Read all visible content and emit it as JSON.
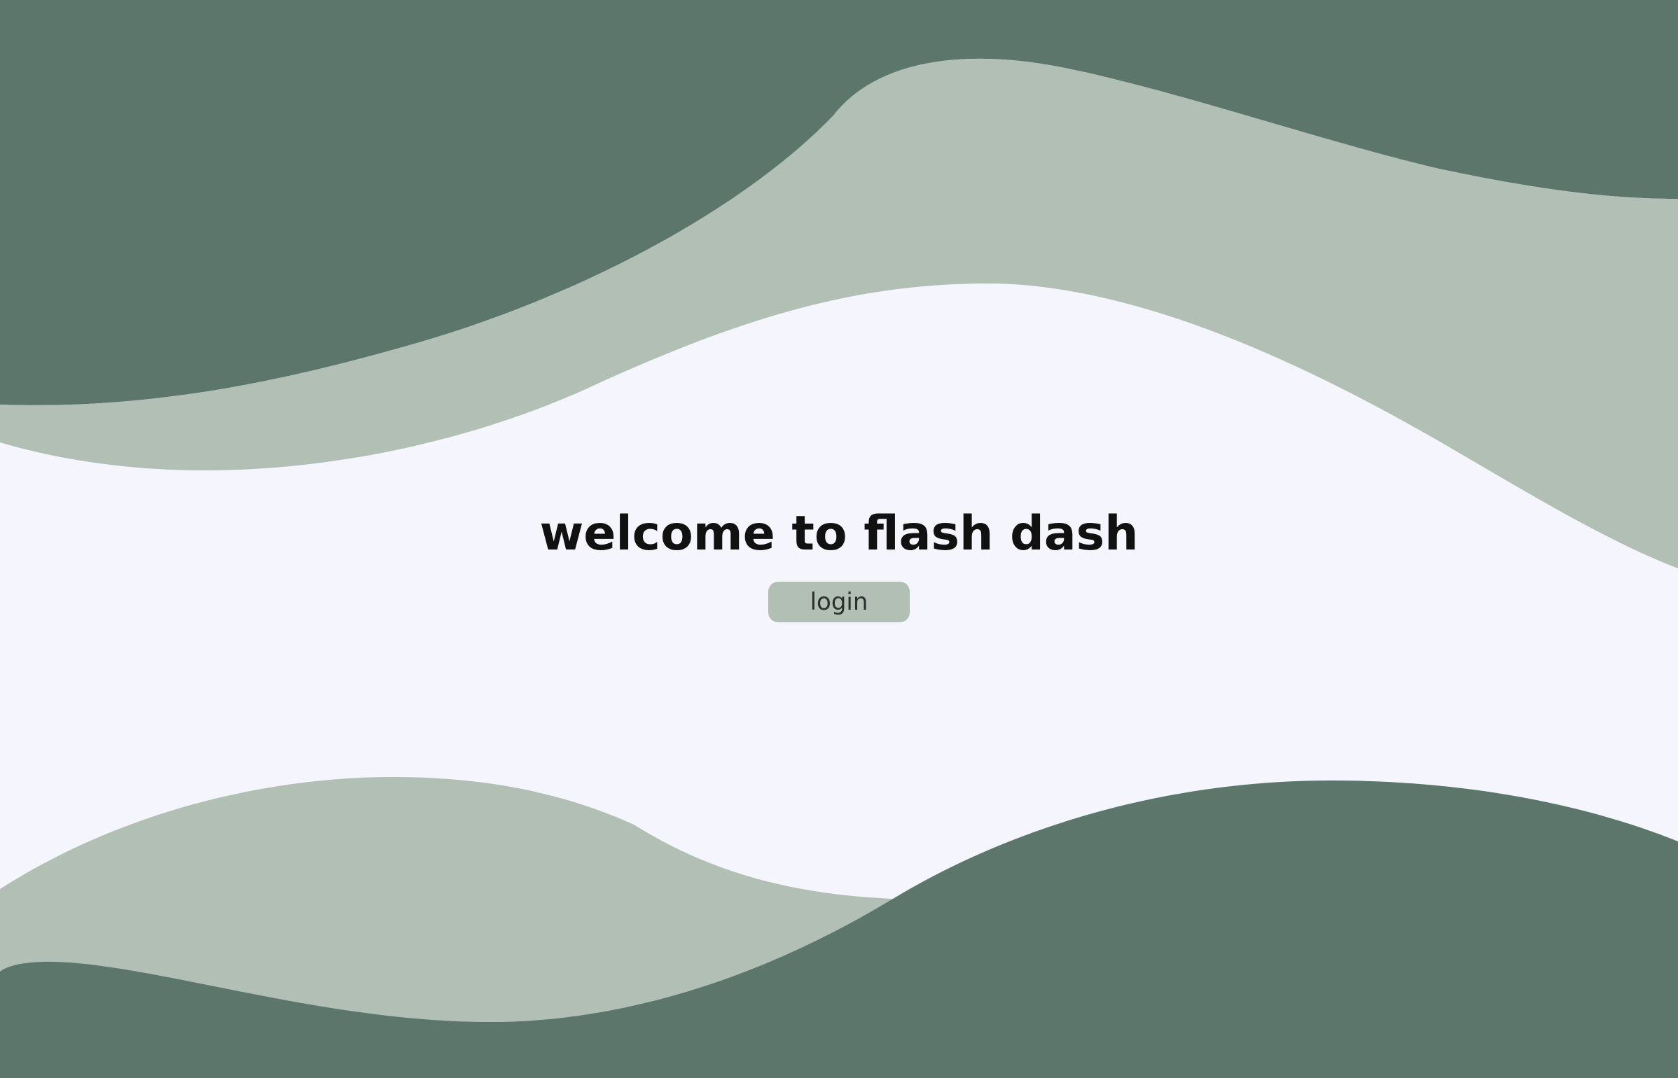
{
  "hero": {
    "title": "welcome to flash dash",
    "login_label": "login"
  },
  "colors": {
    "background": "#f5f6fd",
    "wave_dark": "#5c766c",
    "wave_light": "#b1bfb5",
    "button_bg": "#b1bfb5",
    "title_text": "#111111"
  }
}
